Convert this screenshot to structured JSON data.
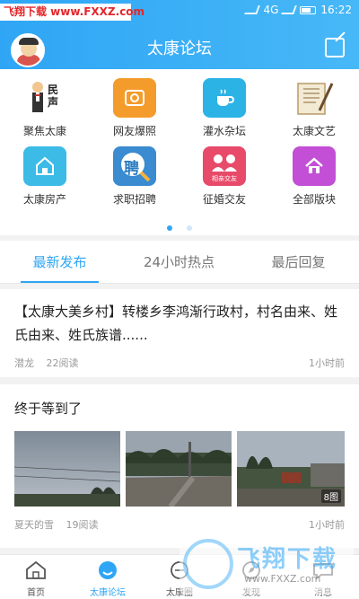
{
  "status": {
    "watermark": "飞翔下载 www.FXXZ.com",
    "network": "4G",
    "time": "16:22"
  },
  "header": {
    "title": "太康论坛"
  },
  "grid": {
    "items": [
      {
        "label": "聚焦太康",
        "icon": "news-icon",
        "color": "#ffffff"
      },
      {
        "label": "网友爆照",
        "icon": "camera-icon",
        "color": "#f39c2b"
      },
      {
        "label": "灌水杂坛",
        "icon": "coffee-icon",
        "color": "#2bb3e6"
      },
      {
        "label": "太康文艺",
        "icon": "scroll-icon",
        "color": "#ffffff"
      },
      {
        "label": "太康房产",
        "icon": "house-icon",
        "color": "#3bbbe6"
      },
      {
        "label": "求职招聘",
        "icon": "recruit-icon",
        "color": "#3a8bd0"
      },
      {
        "label": "征婚交友",
        "icon": "dating-icon",
        "color": "#e84a6a"
      },
      {
        "label": "全部版块",
        "icon": "all-sections-icon",
        "color": "#c24fd6"
      }
    ],
    "recruit_char": "聘",
    "dating_text": "相亲交友",
    "news_text": "民声"
  },
  "tabs": [
    "最新发布",
    "24小时热点",
    "最后回复"
  ],
  "posts": [
    {
      "title": "【太康大美乡村】转楼乡李鸿渐行政村，村名由来、姓氏由来、姓氏族谱......",
      "author": "潜龙",
      "reads": "22阅读",
      "time": "1小时前"
    },
    {
      "title": "终于等到了",
      "author": "夏天的雪",
      "reads": "19阅读",
      "time": "1小时前",
      "image_count": "8图"
    }
  ],
  "nav": [
    {
      "label": "首页",
      "icon": "home-icon"
    },
    {
      "label": "太康论坛",
      "icon": "forum-icon"
    },
    {
      "label": "太康圈",
      "icon": "circle-icon"
    },
    {
      "label": "发现",
      "icon": "discover-icon"
    },
    {
      "label": "消息",
      "icon": "message-icon"
    }
  ],
  "watermark_br": {
    "text": "飞翔下载",
    "url": "www.FXXZ.com"
  },
  "colors": {
    "accent": "#2fa6f5",
    "text": "#222222",
    "muted": "#999999"
  }
}
